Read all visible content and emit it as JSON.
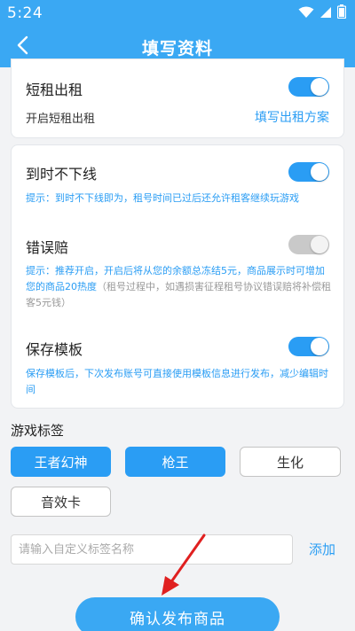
{
  "status_bar": {
    "time": "5:24"
  },
  "header": {
    "title": "填写资料"
  },
  "short_rent": {
    "title": "短租出租",
    "sub_label": "开启短租出租",
    "link_label": "填写出租方案",
    "enabled": true
  },
  "offline": {
    "title": "到时不下线",
    "tip": "提示：到时不下线即为，租号时间已过后还允许租客继续玩游戏",
    "enabled": true
  },
  "error_comp": {
    "title": "错误赔",
    "tip_main": "提示：推荐开启，开启后将从您的余额总冻结5元，商品展示时可增加您的商品20热度",
    "tip_extra": "（租号过程中，如遇损害征程租号协议错误赔将补偿租客5元钱）",
    "enabled": false
  },
  "save_template": {
    "title": "保存模板",
    "tip": "保存模板后，下次发布账号可直接使用模板信息进行发布，减少编辑时间",
    "enabled": true
  },
  "game_tags": {
    "label": "游戏标签",
    "tags": [
      {
        "label": "王者幻神",
        "selected": true
      },
      {
        "label": "枪王",
        "selected": true
      },
      {
        "label": "生化",
        "selected": false
      },
      {
        "label": "音效卡",
        "selected": false
      }
    ]
  },
  "custom_tag": {
    "placeholder": "请输入自定义标签名称",
    "value": "",
    "add_label": "添加"
  },
  "submit": {
    "label": "确认发布商品"
  },
  "colors": {
    "brand": "#3aa8f3",
    "accent": "#2a9df4",
    "annotation_arrow": "#e02020"
  }
}
